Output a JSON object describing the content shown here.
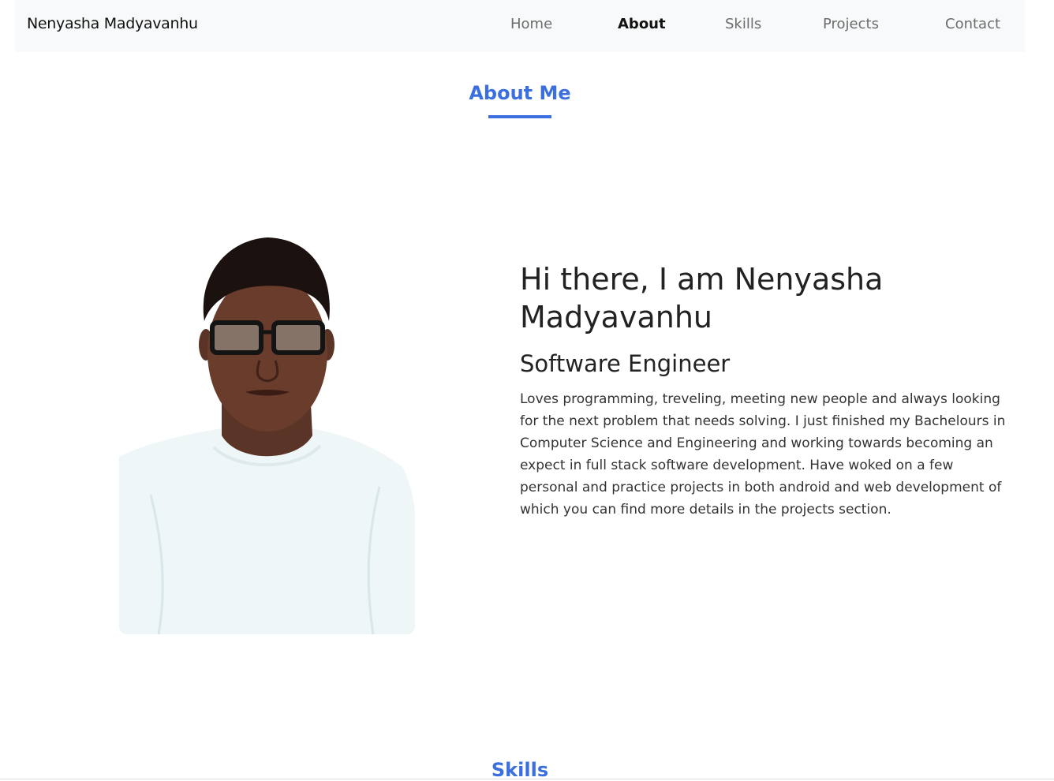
{
  "navbar": {
    "brand": "Nenyasha Madyavanhu",
    "links": [
      {
        "label": "Home"
      },
      {
        "label": "About"
      },
      {
        "label": "Skills"
      },
      {
        "label": "Projects"
      },
      {
        "label": "Contact"
      }
    ],
    "active": "About"
  },
  "about": {
    "section_title": "About Me",
    "greeting": "Hi there, I am Nenyasha Madyavanhu",
    "role": "Software Engineer",
    "bio": "Loves programming, treveling, meeting new people and always looking for the next problem that needs solving. I just finished my Bachelours in Computer Science and Engineering and working towards becoming an expect in full stack software development. Have woked on a few personal and practice projects in both android and web development of which you can find more details in the projects section."
  },
  "skills": {
    "section_title": "Skills"
  },
  "colors": {
    "accent": "#3b6fe0",
    "navbar_bg": "#f8f9fa",
    "nav_text": "#6c6c6c",
    "nav_active": "#111111"
  }
}
